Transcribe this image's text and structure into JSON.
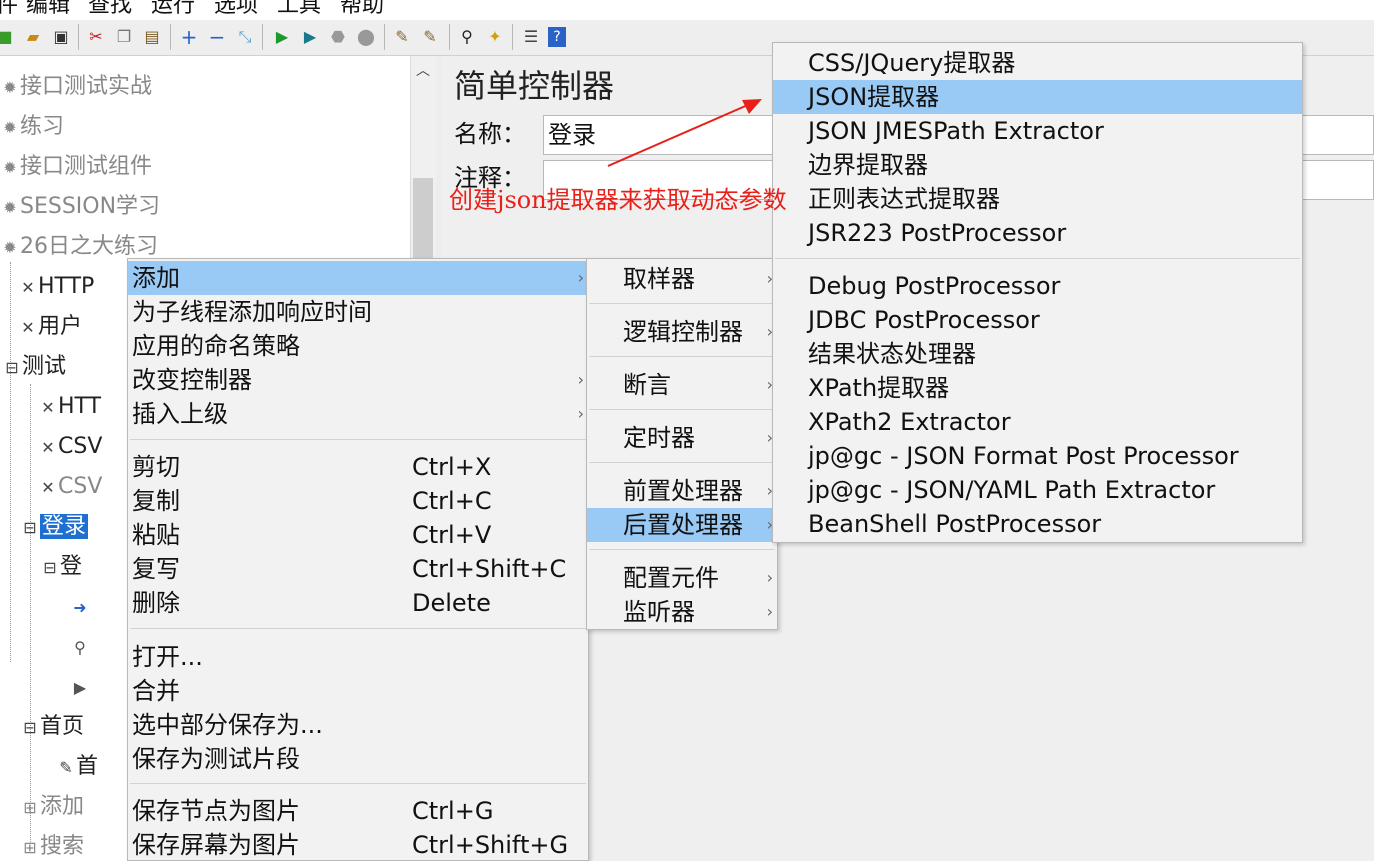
{
  "menubar": {
    "items": [
      "件",
      "编辑",
      "查找",
      "运行",
      "选项",
      "工具",
      "帮助"
    ]
  },
  "toolbar": {
    "icons": [
      "templates-icon",
      "open-icon",
      "save-icon",
      "cut-icon",
      "copy-icon",
      "paste-icon",
      "expand-icon",
      "collapse-icon",
      "toggle-icon",
      "start-icon",
      "start-no-pause-icon",
      "stop-icon",
      "shutdown-icon",
      "clear-icon",
      "clear-all-icon",
      "search-icon",
      "reset-search-icon",
      "function-helper-icon",
      "help-icon"
    ]
  },
  "tree": {
    "nodes": [
      {
        "label": "接口测试实战"
      },
      {
        "label": "练习"
      },
      {
        "label": "接口测试组件"
      },
      {
        "label": "SESSION学习"
      },
      {
        "label": "26日之大练习"
      },
      {
        "label": "HTTP"
      },
      {
        "label": "用户"
      },
      {
        "label": "测试"
      },
      {
        "label": "HTT"
      },
      {
        "label": "CSV"
      },
      {
        "label": "CSV"
      },
      {
        "label": "登录"
      },
      {
        "label": "登"
      },
      {
        "label": ""
      },
      {
        "label": ""
      },
      {
        "label": ""
      },
      {
        "label": "首页"
      },
      {
        "label": "首"
      },
      {
        "label": "添加"
      },
      {
        "label": "搜索"
      }
    ]
  },
  "editor": {
    "title": "简单控制器",
    "name_label": "名称：",
    "name_value": "登录",
    "comment_label": "注释："
  },
  "context_menu": {
    "items": [
      {
        "label": "添加",
        "shortcut": "",
        "submenu": true
      },
      {
        "label": "为子线程添加响应时间",
        "shortcut": "",
        "submenu": false
      },
      {
        "label": "应用的命名策略",
        "shortcut": "",
        "submenu": false
      },
      {
        "label": "改变控制器",
        "shortcut": "",
        "submenu": true
      },
      {
        "label": "插入上级",
        "shortcut": "",
        "submenu": true
      },
      {
        "label": "剪切",
        "shortcut": "Ctrl+X",
        "submenu": false
      },
      {
        "label": "复制",
        "shortcut": "Ctrl+C",
        "submenu": false
      },
      {
        "label": "粘贴",
        "shortcut": "Ctrl+V",
        "submenu": false
      },
      {
        "label": "复写",
        "shortcut": "Ctrl+Shift+C",
        "submenu": false
      },
      {
        "label": "删除",
        "shortcut": "Delete",
        "submenu": false
      },
      {
        "label": "打开...",
        "shortcut": "",
        "submenu": false
      },
      {
        "label": "合并",
        "shortcut": "",
        "submenu": false
      },
      {
        "label": "选中部分保存为...",
        "shortcut": "",
        "submenu": false
      },
      {
        "label": "保存为测试片段",
        "shortcut": "",
        "submenu": false
      },
      {
        "label": "保存节点为图片",
        "shortcut": "Ctrl+G",
        "submenu": false
      },
      {
        "label": "保存屏幕为图片",
        "shortcut": "Ctrl+Shift+G",
        "submenu": false
      }
    ]
  },
  "add_submenu": {
    "items": [
      {
        "label": "取样器"
      },
      {
        "label": "逻辑控制器"
      },
      {
        "label": "断言"
      },
      {
        "label": "定时器"
      },
      {
        "label": "前置处理器"
      },
      {
        "label": "后置处理器"
      },
      {
        "label": "配置元件"
      },
      {
        "label": "监听器"
      }
    ]
  },
  "post_processor_submenu": {
    "items": [
      {
        "label": "CSS/JQuery提取器"
      },
      {
        "label": "JSON提取器"
      },
      {
        "label": "JSON JMESPath Extractor"
      },
      {
        "label": "边界提取器"
      },
      {
        "label": "正则表达式提取器"
      },
      {
        "label": "JSR223 PostProcessor"
      },
      {
        "label": "Debug PostProcessor"
      },
      {
        "label": "JDBC PostProcessor"
      },
      {
        "label": "结果状态处理器"
      },
      {
        "label": "XPath提取器"
      },
      {
        "label": "XPath2 Extractor"
      },
      {
        "label": "jp@gc - JSON Format Post Processor"
      },
      {
        "label": "jp@gc - JSON/YAML Path Extractor"
      },
      {
        "label": "BeanShell PostProcessor"
      }
    ]
  },
  "annotation": {
    "text": "创建json提取器来获取动态参数",
    "color": "#e8201a"
  },
  "colors": {
    "menu_highlight": "#99c9f5",
    "tree_selection": "#1f6fd1"
  }
}
